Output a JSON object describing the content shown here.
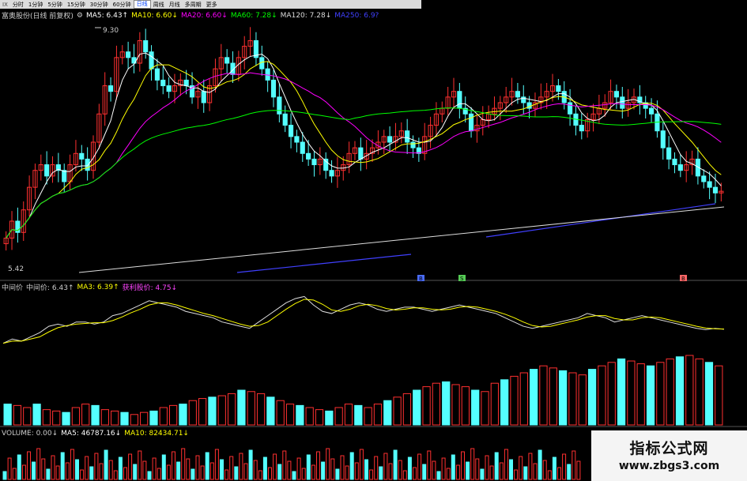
{
  "toolbar": {
    "first": "IX",
    "tabs": [
      "分时",
      "1分钟",
      "5分钟",
      "15分钟",
      "30分钟",
      "60分钟",
      "日线",
      "周线",
      "月线",
      "多周期",
      "更多"
    ],
    "active_tab": "日线"
  },
  "ma_header": {
    "stock": "富奥股份(日线 前复权)",
    "items": [
      {
        "label": "MA5: 6.43↑",
        "color": "#ffffff"
      },
      {
        "label": "MA10: 6.60↓",
        "color": "#ffff00"
      },
      {
        "label": "MA20: 6.60↓",
        "color": "#ff00ff"
      },
      {
        "label": "MA60: 7.28↓",
        "color": "#00ff00"
      },
      {
        "label": "MA120: 7.28↓",
        "color": "#dddddd"
      },
      {
        "label": "MA250: 6.9?",
        "color": "#4040ff"
      }
    ]
  },
  "price_labels": {
    "high": "9.30",
    "low": "5.42"
  },
  "mid_header": {
    "items": [
      {
        "label": "中间价",
        "color": "#cccccc"
      },
      {
        "label": "中间价: 6.43↑",
        "color": "#cccccc"
      },
      {
        "label": "MA3: 6.39↑",
        "color": "#ffff00"
      },
      {
        "label": "获利股价: 4.75↓",
        "color": "#ff44ff"
      }
    ]
  },
  "vol_header": {
    "items": [
      {
        "label": "VOLUME: 0.00↓",
        "color": "#cccccc"
      },
      {
        "label": "MA5: 46787.16↓",
        "color": "#ffffff"
      },
      {
        "label": "MA10: 82434.71↓",
        "color": "#ffff00"
      }
    ]
  },
  "markers": [
    {
      "label": "B",
      "color": "#4a6cff"
    },
    {
      "label": "S",
      "color": "#55cc55"
    },
    {
      "label": "B",
      "color": "#ff6666"
    }
  ],
  "watermark": {
    "title": "指标公式网",
    "url": "www.zbgs3.com"
  },
  "colors": {
    "up": "#ff3030",
    "down": "#54ffff",
    "ma5": "#ffffff",
    "ma10": "#ffff00",
    "ma20": "#ff00ff",
    "ma60": "#00ff00",
    "ma250": "#4040ff"
  },
  "chart_data": {
    "type": "candlestick",
    "panels": [
      "price",
      "mid_price",
      "volume"
    ],
    "price_range": [
      5.42,
      9.3
    ],
    "closes": [
      5.6,
      5.9,
      5.7,
      6.1,
      6.5,
      6.8,
      6.9,
      6.7,
      6.9,
      6.8,
      6.6,
      6.9,
      7.1,
      7.0,
      6.8,
      7.3,
      7.8,
      8.3,
      8.2,
      8.8,
      8.9,
      8.8,
      8.7,
      9.1,
      8.9,
      8.6,
      8.4,
      8.3,
      8.2,
      8.3,
      8.4,
      8.3,
      8.1,
      8.2,
      8.0,
      8.3,
      8.6,
      8.8,
      8.7,
      8.5,
      8.8,
      9.0,
      9.1,
      8.8,
      8.6,
      8.4,
      8.1,
      7.8,
      7.6,
      7.4,
      7.3,
      7.1,
      7.0,
      6.9,
      7.0,
      6.8,
      6.7,
      6.8,
      6.9,
      7.1,
      7.2,
      7.0,
      7.1,
      7.2,
      7.3,
      7.4,
      7.3,
      7.4,
      7.5,
      7.3,
      7.2,
      7.1,
      7.4,
      7.6,
      7.8,
      7.9,
      8.1,
      8.2,
      7.9,
      7.8,
      7.5,
      7.6,
      7.7,
      7.8,
      7.9,
      8.0,
      8.1,
      8.2,
      8.1,
      8.0,
      7.9,
      8.0,
      8.1,
      8.2,
      8.3,
      8.2,
      8.0,
      7.8,
      7.6,
      7.5,
      7.7,
      7.8,
      7.9,
      8.0,
      8.2,
      8.1,
      7.9,
      8.0,
      8.1,
      8.0,
      7.9,
      7.8,
      7.5,
      7.2,
      7.0,
      6.9,
      6.8,
      6.9,
      7.0,
      6.7,
      6.6,
      6.5,
      6.4,
      6.43
    ],
    "mid_price": [
      5.1,
      5.2,
      5.15,
      5.25,
      5.35,
      5.5,
      5.55,
      5.5,
      5.6,
      5.6,
      5.55,
      5.6,
      5.75,
      5.8,
      5.9,
      6.0,
      6.1,
      6.05,
      6.0,
      5.95,
      5.85,
      5.8,
      5.75,
      5.7,
      5.6,
      5.55,
      5.5,
      5.45,
      5.6,
      5.75,
      5.9,
      6.05,
      6.15,
      6.2,
      6.0,
      5.85,
      5.8,
      5.9,
      6.0,
      6.05,
      6.0,
      5.9,
      5.85,
      5.9,
      5.95,
      5.95,
      5.9,
      5.85,
      5.9,
      5.95,
      6.0,
      5.95,
      5.9,
      5.85,
      5.8,
      5.7,
      5.6,
      5.5,
      5.45,
      5.5,
      5.55,
      5.6,
      5.65,
      5.7,
      5.8,
      5.75,
      5.7,
      5.6,
      5.65,
      5.7,
      5.75,
      5.7,
      5.65,
      5.6,
      5.55,
      5.5,
      5.45,
      5.42,
      5.45,
      5.43
    ],
    "volume": [
      30,
      28,
      25,
      30,
      22,
      20,
      18,
      25,
      30,
      28,
      22,
      20,
      18,
      15,
      18,
      20,
      25,
      28,
      30,
      35,
      38,
      40,
      42,
      45,
      50,
      48,
      45,
      40,
      35,
      30,
      28,
      25,
      22,
      20,
      25,
      30,
      28,
      25,
      30,
      35,
      40,
      45,
      50,
      55,
      60,
      62,
      58,
      55,
      50,
      48,
      60,
      65,
      70,
      75,
      80,
      85,
      82,
      78,
      75,
      72,
      80,
      85,
      90,
      95,
      92,
      88,
      85,
      90,
      95,
      98,
      100,
      95,
      90,
      85
    ]
  }
}
